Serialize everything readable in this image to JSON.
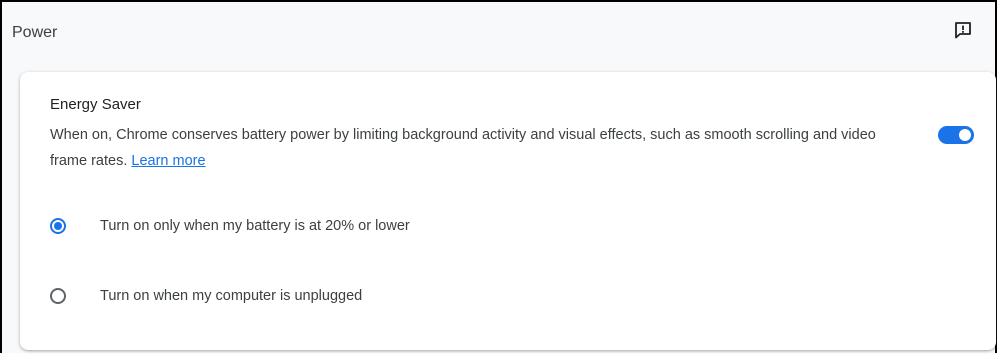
{
  "page": {
    "title": "Power",
    "feedback_icon": "feedback-icon"
  },
  "energy_saver": {
    "title": "Energy Saver",
    "description": "When on, Chrome conserves battery power by limiting background activity and visual effects, such as smooth scrolling and video frame rates.",
    "learn_more": "Learn more",
    "enabled": true
  },
  "options": [
    {
      "label": "Turn on only when my battery is at 20% or lower",
      "selected": true
    },
    {
      "label": "Turn on when my computer is unplugged",
      "selected": false
    }
  ],
  "colors": {
    "accent": "#1a73e8",
    "text": "#3c4043",
    "background": "#f8f9fa"
  }
}
